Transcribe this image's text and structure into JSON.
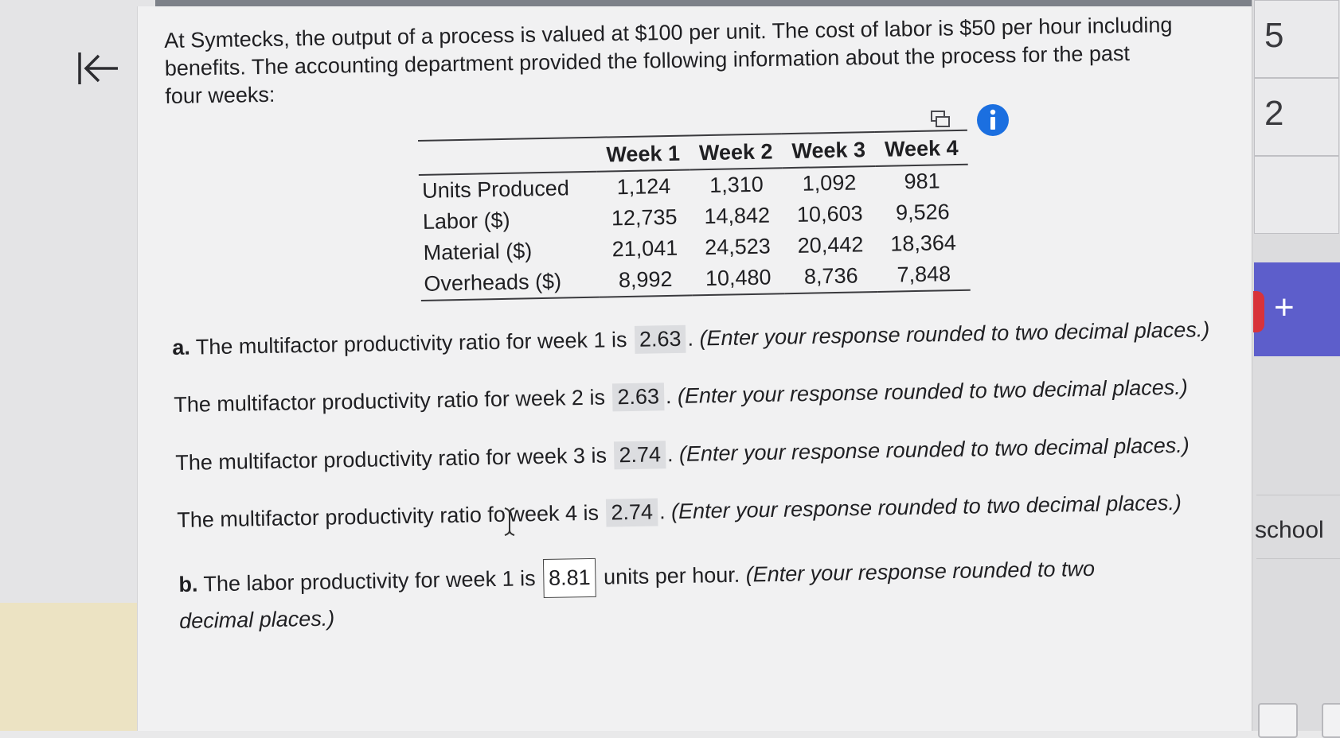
{
  "problem": {
    "line1": "At Symtecks, the output of a process is valued at $100 per unit. The cost of labor is $50 per hour including",
    "line2": "benefits. The accounting department provided the following information about the process for the past",
    "line3": "four weeks:"
  },
  "table": {
    "columns": [
      "Week 1",
      "Week 2",
      "Week 3",
      "Week 4"
    ],
    "rows": [
      {
        "label": "Units Produced",
        "values": [
          "1,124",
          "1,310",
          "1,092",
          "981"
        ]
      },
      {
        "label": "Labor ($)",
        "values": [
          "12,735",
          "14,842",
          "10,603",
          "9,526"
        ]
      },
      {
        "label": "Material ($)",
        "values": [
          "21,041",
          "24,523",
          "20,442",
          "18,364"
        ]
      },
      {
        "label": "Overheads ($)",
        "values": [
          "8,992",
          "10,480",
          "8,736",
          "7,848"
        ]
      }
    ]
  },
  "questions": {
    "a_prefix": "a.",
    "q1_text": "The multifactor productivity ratio for week 1 is",
    "q1_answer": "2.63",
    "q2_text": "The multifactor productivity ratio for week 2 is",
    "q2_answer": "2.63",
    "q3_text": "The multifactor productivity ratio for week 3 is",
    "q3_answer": "2.74",
    "q4_text": "The multifactor productivity ratio fo",
    "q4_text_b": "week 4 is",
    "q4_answer": "2.74",
    "hint": "(Enter your response rounded to two decimal places.)",
    "b_prefix": "b.",
    "q5_text": "The labor productivity for week 1 is",
    "q5_answer": "8.81",
    "q5_suffix": "units per hour.",
    "q5_hint_a": "(Enter your response rounded to two",
    "q5_hint_b": "decimal places.)"
  },
  "right_panel": {
    "num1": "5",
    "num2": "2",
    "plus": "+",
    "school": "school"
  },
  "icons": {
    "back": "back-to-start-icon",
    "copy": "copy-icon",
    "info": "info-icon",
    "cursor": "text-cursor-icon"
  },
  "colors": {
    "info_blue": "#1b6fe0",
    "plus_bar": "#5d5ecb",
    "red_tab": "#d8333a"
  }
}
